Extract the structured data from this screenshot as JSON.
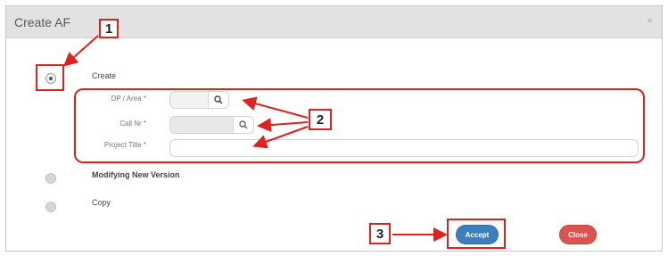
{
  "dialog": {
    "title": "Create AF",
    "close_symbol": "×"
  },
  "options": [
    {
      "label": "Create",
      "checked": true
    },
    {
      "label": "Modifying New Version",
      "checked": false
    },
    {
      "label": "Copy",
      "checked": false
    }
  ],
  "fields": {
    "dp_area_label": "DP / Area *",
    "call_nr_label": "Call Nr *",
    "project_title_label": "Project Title *"
  },
  "buttons": {
    "accept": "Accept",
    "close": "Close"
  },
  "annotations": {
    "step1": "1",
    "step2": "2",
    "step3": "3",
    "color": "#e0221c"
  },
  "icons": {
    "search": "search-icon"
  }
}
